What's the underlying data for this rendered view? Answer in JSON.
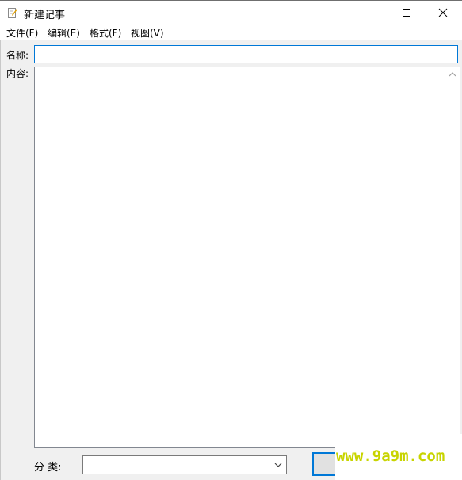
{
  "window": {
    "title": "新建记事",
    "icon": "note-edit-icon",
    "controls": [
      "minimize-icon",
      "maximize-icon",
      "close-icon"
    ]
  },
  "menu": [
    {
      "label": "文件(F)"
    },
    {
      "label": "编辑(E)"
    },
    {
      "label": "格式(F)"
    },
    {
      "label": "视图(V)"
    }
  ],
  "form": {
    "name_label": "名称:",
    "name_value": "",
    "content_label": "内容:",
    "content_value": "",
    "category_label": "分 类:",
    "category_value": "",
    "action_button_label": ""
  },
  "watermark": {
    "text": "www.9a9m.com"
  },
  "colors": {
    "focus_border": "#0078d7",
    "watermark": "#c8d400"
  }
}
